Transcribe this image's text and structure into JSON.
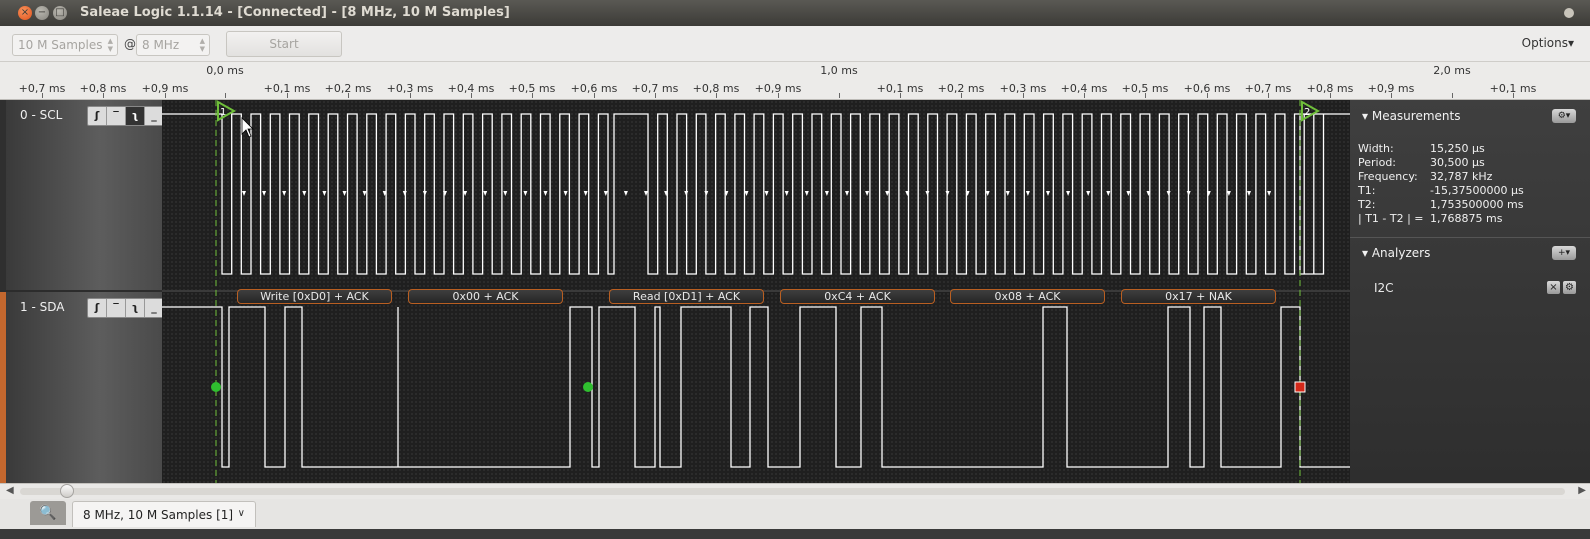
{
  "window": {
    "title": "Saleae Logic 1.1.14 - [Connected] - [8 MHz, 10 M Samples]",
    "close_glyph": "×",
    "min_glyph": "−",
    "max_glyph": "□"
  },
  "toolbar": {
    "samples_value": "10 M Samples",
    "at_label": "@",
    "rate_value": "8 MHz",
    "start_label": "Start",
    "options_label": "Options▾"
  },
  "ruler": {
    "major_labels": [
      "0,0 ms",
      "1,0 ms",
      "2,0 ms"
    ],
    "tick_labels": [
      "+0,7 ms",
      "+0,8 ms",
      "+0,9 ms",
      "+0,1 ms",
      "+0,2 ms",
      "+0,3 ms",
      "+0,4 ms",
      "+0,5 ms",
      "+0,6 ms",
      "+0,7 ms",
      "+0,8 ms",
      "+0,9 ms",
      "+0,1 ms",
      "+0,2 ms",
      "+0,3 ms",
      "+0,4 ms",
      "+0,5 ms",
      "+0,6 ms",
      "+0,7 ms",
      "+0,8 ms",
      "+0,9 ms",
      "+0,1 ms"
    ]
  },
  "channels": [
    {
      "name": "0 - SCL",
      "trigger_buttons": [
        "ʃ",
        "‾",
        "ʅ",
        "_"
      ],
      "selected_trigger": 2
    },
    {
      "name": "1 - SDA",
      "trigger_buttons": [
        "ʃ",
        "‾",
        "ʅ",
        "_"
      ],
      "selected_trigger": -1
    }
  ],
  "markers": {
    "t1_label": "1",
    "t2_label": "2"
  },
  "decoded_frames": [
    "Write [0xD0] + ACK",
    "0x00 + ACK",
    "Read [0xD1] + ACK",
    "0xC4 + ACK",
    "0x08 + ACK",
    "0x17 + NAK"
  ],
  "sidebar": {
    "measurements": {
      "header": "Measurements",
      "settings_glyph": "⚙▾",
      "rows": [
        {
          "label": "Width:",
          "value": "15,250 µs"
        },
        {
          "label": "Period:",
          "value": "30,500 µs"
        },
        {
          "label": "Frequency:",
          "value": "32,787 kHz"
        },
        {
          "label": "T1:",
          "value": "-15,37500000 µs"
        },
        {
          "label": "T2:",
          "value": "1,753500000 ms"
        },
        {
          "label": "| T1 - T2 | =",
          "value": "1,768875 ms"
        }
      ]
    },
    "analyzers": {
      "header": "Analyzers",
      "add_glyph": "+▾",
      "items": [
        {
          "name": "I2C",
          "close_glyph": "×",
          "settings_glyph": "⚙"
        }
      ]
    }
  },
  "bottom": {
    "search_glyph": "🔍",
    "session_tab": "8 MHz, 10 M Samples [1]",
    "session_dropdown": "∨",
    "scroll_left": "◀",
    "scroll_right": "▶"
  },
  "colors": {
    "waveform": "#ffffff",
    "cursor_marker": "#6fbf3a",
    "frame_border": "#b95f22",
    "start_dot": "#2fbf2f",
    "stop_square": "#d42a1a"
  }
}
